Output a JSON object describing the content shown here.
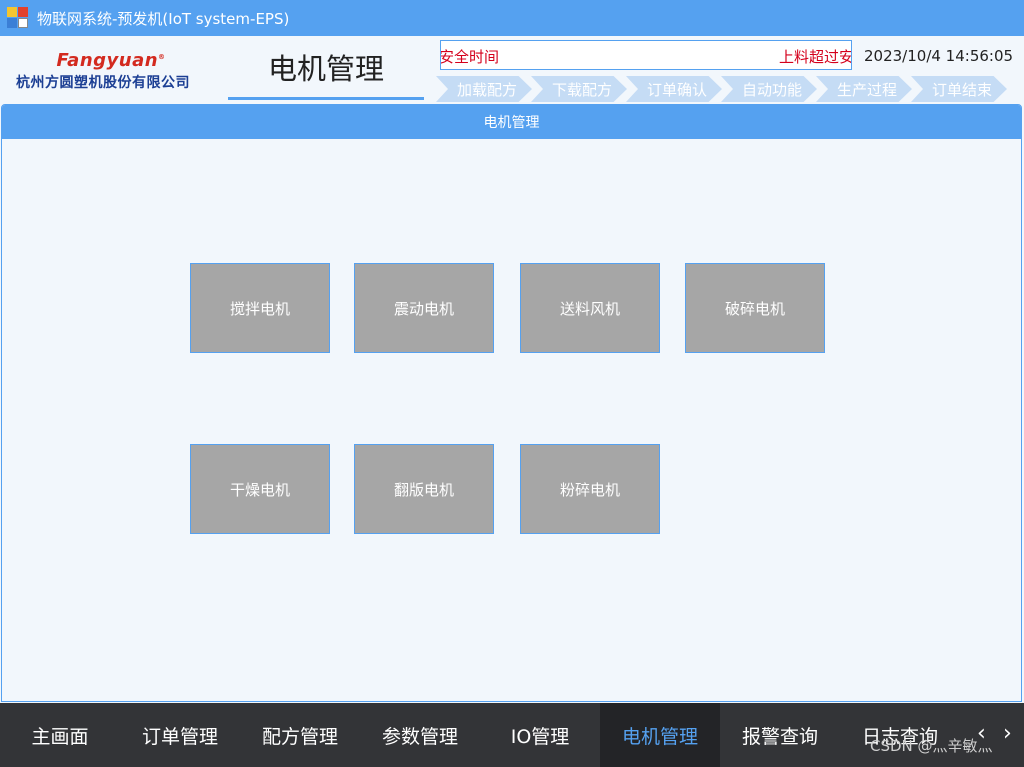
{
  "window": {
    "title": "物联网系统-预发机(IoT system-EPS)"
  },
  "header": {
    "logo_brand": "Fangyuan",
    "logo_reg": "®",
    "logo_company": "杭州方圆塑机股份有限公司",
    "page_title": "电机管理",
    "marquee_left": "安全时间",
    "marquee_right": "上料超过安",
    "datetime": "2023/10/4 14:56:05"
  },
  "steps": [
    "加载配方",
    "下载配方",
    "订单确认",
    "自动功能",
    "生产过程",
    "订单结束"
  ],
  "panel": {
    "title": "电机管理"
  },
  "motors": [
    "搅拌电机",
    "震动电机",
    "送料风机",
    "破碎电机",
    "干燥电机",
    "翻版电机",
    "粉碎电机"
  ],
  "nav": {
    "items": [
      "主画面",
      "订单管理",
      "配方管理",
      "参数管理",
      "IO管理",
      "电机管理",
      "报警查询",
      "日志查询"
    ],
    "active": "电机管理",
    "prev_icon": "chevron-left-icon",
    "next_icon": "chevron-right-icon"
  },
  "watermark": "CSDN @灬辛敏灬",
  "colors": {
    "accent": "#55a1f0",
    "button_gray": "#a6a6a6",
    "nav_bg": "#333437",
    "alert_red": "#d4001c"
  }
}
